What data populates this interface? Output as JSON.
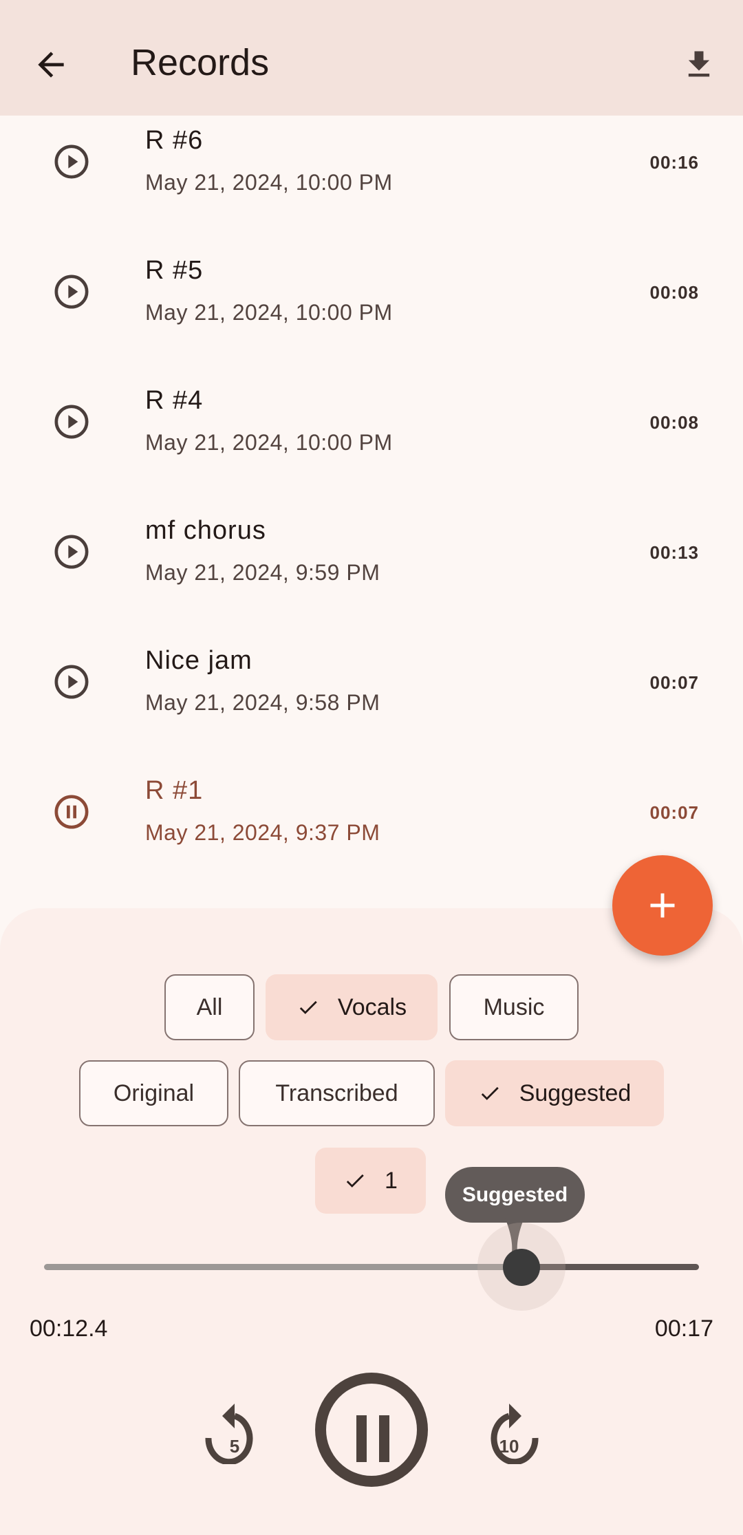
{
  "header": {
    "title": "Records",
    "back_icon": "arrow-back-icon",
    "download_icon": "download-icon"
  },
  "records": [
    {
      "title": "R #6",
      "date": "May 21, 2024, 10:00 PM",
      "duration": "00:16",
      "state": "play"
    },
    {
      "title": "R #5",
      "date": "May 21, 2024, 10:00 PM",
      "duration": "00:08",
      "state": "play"
    },
    {
      "title": "R #4",
      "date": "May 21, 2024, 10:00 PM",
      "duration": "00:08",
      "state": "play"
    },
    {
      "title": "mf chorus",
      "date": "May 21, 2024, 9:59 PM",
      "duration": "00:13",
      "state": "play"
    },
    {
      "title": "Nice jam",
      "date": "May 21, 2024, 9:58 PM",
      "duration": "00:07",
      "state": "play"
    },
    {
      "title": "R #1",
      "date": "May 21, 2024, 9:37 PM",
      "duration": "00:07",
      "state": "pause"
    }
  ],
  "fab": {
    "icon": "plus-icon",
    "color": "#ee6436"
  },
  "filters": {
    "row1": [
      {
        "label": "All",
        "selected": false
      },
      {
        "label": "Vocals",
        "selected": true
      },
      {
        "label": "Music",
        "selected": false
      }
    ],
    "row2": [
      {
        "label": "Original",
        "selected": false
      },
      {
        "label": "Transcribed",
        "selected": false
      },
      {
        "label": "Suggested",
        "selected": true
      }
    ],
    "row3": [
      {
        "label": "1",
        "selected": true
      }
    ]
  },
  "player": {
    "tooltip": "Suggested",
    "position": "00:12.4",
    "duration": "00:17",
    "progress_seconds": 12.4,
    "total_seconds": 17,
    "rewind_label": "5",
    "forward_label": "10"
  },
  "colors": {
    "accent": "#8c4a37",
    "fab": "#ee6436",
    "header": "#f3e2dc",
    "chip_selected": "#f9dcd3"
  }
}
